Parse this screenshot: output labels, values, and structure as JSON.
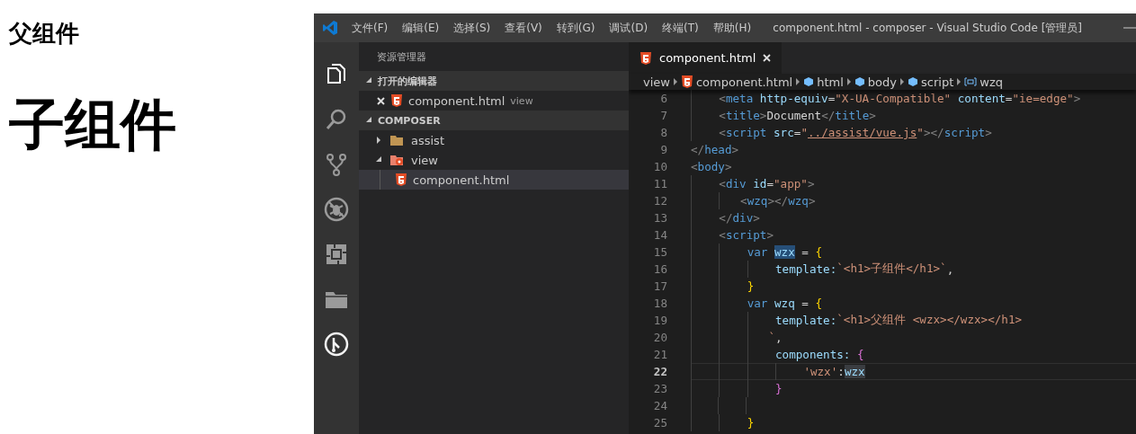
{
  "page": {
    "headings": [
      {
        "text": "父组件",
        "kind": "small"
      },
      {
        "text": "子组件",
        "kind": "large"
      }
    ]
  },
  "window": {
    "title": "component.html - composer - Visual Studio Code [管理员]",
    "menu": [
      "文件(F)",
      "编辑(E)",
      "选择(S)",
      "查看(V)",
      "转到(G)",
      "调试(D)",
      "终端(T)",
      "帮助(H)"
    ]
  },
  "activity_bar": [
    {
      "kind": "files",
      "selected": true
    },
    {
      "kind": "search",
      "selected": false
    },
    {
      "kind": "source-control",
      "selected": false
    },
    {
      "kind": "debug",
      "selected": false
    },
    {
      "kind": "extensions",
      "selected": false
    },
    {
      "kind": "folder",
      "selected": false
    },
    {
      "kind": "branch",
      "selected": false
    }
  ],
  "sidebar": {
    "title": "资源管理器",
    "sections": [
      {
        "title": "打开的编辑器",
        "expanded": true,
        "items": [
          {
            "label": "component.html",
            "description": "view",
            "kind": "file",
            "selected": false
          }
        ]
      },
      {
        "title": "COMPOSER",
        "expanded": true,
        "items": [
          {
            "label": "assist",
            "kind": "folder",
            "expanded": false,
            "selected": false
          },
          {
            "label": "view",
            "kind": "vue-folder",
            "expanded": true,
            "selected": false,
            "children": [
              {
                "label": "component.html",
                "kind": "file",
                "selected": true
              }
            ]
          }
        ]
      }
    ]
  },
  "editor": {
    "tabs": [
      {
        "label": "component.html",
        "selected": true
      }
    ],
    "breadcrumb": [
      {
        "label": "view",
        "kind": "folder"
      },
      {
        "label": "component.html",
        "kind": "file"
      },
      {
        "label": "html",
        "kind": "element"
      },
      {
        "label": "body",
        "kind": "element"
      },
      {
        "label": "script",
        "kind": "element"
      },
      {
        "label": "wzq",
        "kind": "variable"
      }
    ],
    "lines": [
      {
        "number": "6",
        "current": false,
        "tokens": [
          {
            "text": "    <",
            "kind": "punct"
          },
          {
            "text": "meta",
            "kind": "tag"
          },
          {
            "text": " http-equiv",
            "kind": "attr"
          },
          {
            "text": "=",
            "kind": "text"
          },
          {
            "text": "\"X-UA-Compatible\"",
            "kind": "string"
          },
          {
            "text": " content",
            "kind": "attr"
          },
          {
            "text": "=",
            "kind": "text"
          },
          {
            "text": "\"ie=edge\"",
            "kind": "string"
          },
          {
            "text": ">",
            "kind": "punct"
          }
        ]
      },
      {
        "number": "7",
        "current": false,
        "tokens": [
          {
            "text": "    <",
            "kind": "punct"
          },
          {
            "text": "title",
            "kind": "tag"
          },
          {
            "text": ">",
            "kind": "punct"
          },
          {
            "text": "Document",
            "kind": "text"
          },
          {
            "text": "</",
            "kind": "punct"
          },
          {
            "text": "title",
            "kind": "tag"
          },
          {
            "text": ">",
            "kind": "punct"
          }
        ]
      },
      {
        "number": "8",
        "current": false,
        "tokens": [
          {
            "text": "    <",
            "kind": "punct"
          },
          {
            "text": "script",
            "kind": "tag"
          },
          {
            "text": " src",
            "kind": "attr"
          },
          {
            "text": "=",
            "kind": "text"
          },
          {
            "text": "\"",
            "kind": "string"
          },
          {
            "text": "../assist/vue.js",
            "kind": "link"
          },
          {
            "text": "\"",
            "kind": "string"
          },
          {
            "text": "></",
            "kind": "punct"
          },
          {
            "text": "script",
            "kind": "tag"
          },
          {
            "text": ">",
            "kind": "punct"
          }
        ]
      },
      {
        "number": "9",
        "current": false,
        "tokens": [
          {
            "text": "</",
            "kind": "punct"
          },
          {
            "text": "head",
            "kind": "tag"
          },
          {
            "text": ">",
            "kind": "punct"
          }
        ]
      },
      {
        "number": "10",
        "current": false,
        "tokens": [
          {
            "text": "<",
            "kind": "punct"
          },
          {
            "text": "body",
            "kind": "tag"
          },
          {
            "text": ">",
            "kind": "punct"
          }
        ]
      },
      {
        "number": "11",
        "current": false,
        "tokens": [
          {
            "text": "    <",
            "kind": "punct"
          },
          {
            "text": "div",
            "kind": "tag"
          },
          {
            "text": " id",
            "kind": "attr"
          },
          {
            "text": "=",
            "kind": "text"
          },
          {
            "text": "\"app\"",
            "kind": "string"
          },
          {
            "text": ">",
            "kind": "punct"
          }
        ]
      },
      {
        "number": "12",
        "current": false,
        "tokens": [
          {
            "text": "       <",
            "kind": "punct"
          },
          {
            "text": "wzq",
            "kind": "tag"
          },
          {
            "text": "></",
            "kind": "punct"
          },
          {
            "text": "wzq",
            "kind": "tag"
          },
          {
            "text": ">",
            "kind": "punct"
          }
        ]
      },
      {
        "number": "13",
        "current": false,
        "tokens": [
          {
            "text": "    </",
            "kind": "punct"
          },
          {
            "text": "div",
            "kind": "tag"
          },
          {
            "text": ">",
            "kind": "punct"
          }
        ]
      },
      {
        "number": "14",
        "current": false,
        "tokens": [
          {
            "text": "    <",
            "kind": "punct"
          },
          {
            "text": "script",
            "kind": "tag"
          },
          {
            "text": ">",
            "kind": "punct"
          }
        ]
      },
      {
        "number": "15",
        "current": false,
        "tokens": [
          {
            "text": "        var ",
            "kind": "keyword"
          },
          {
            "text": "wzx",
            "kind": "variable",
            "selection": true
          },
          {
            "text": " = ",
            "kind": "text"
          },
          {
            "text": "{",
            "kind": "brace"
          }
        ]
      },
      {
        "number": "16",
        "current": false,
        "tokens": [
          {
            "text": "            template:",
            "kind": "property"
          },
          {
            "text": "`<h1>子组件</h1>`",
            "kind": "string"
          },
          {
            "text": ",",
            "kind": "text"
          }
        ]
      },
      {
        "number": "17",
        "current": false,
        "tokens": [
          {
            "text": "        }",
            "kind": "brace"
          }
        ]
      },
      {
        "number": "18",
        "current": false,
        "tokens": [
          {
            "text": "        var ",
            "kind": "keyword"
          },
          {
            "text": "wzq",
            "kind": "variable"
          },
          {
            "text": " = ",
            "kind": "text"
          },
          {
            "text": "{",
            "kind": "brace"
          }
        ]
      },
      {
        "number": "19",
        "current": false,
        "tokens": [
          {
            "text": "            template:",
            "kind": "property"
          },
          {
            "text": "`<h1>父组件 <wzx></wzx></h1>",
            "kind": "string"
          }
        ]
      },
      {
        "number": "20",
        "current": false,
        "tokens": [
          {
            "text": "           `",
            "kind": "string"
          },
          {
            "text": ",",
            "kind": "text"
          }
        ]
      },
      {
        "number": "21",
        "current": false,
        "tokens": [
          {
            "text": "            components: ",
            "kind": "property"
          },
          {
            "text": "{",
            "kind": "brace2"
          }
        ]
      },
      {
        "number": "22",
        "current": true,
        "tokens": [
          {
            "text": "                'wzx'",
            "kind": "string"
          },
          {
            "text": ":",
            "kind": "text"
          },
          {
            "text": "wzx",
            "kind": "variable",
            "occurrence": true
          }
        ]
      },
      {
        "number": "23",
        "current": false,
        "tokens": [
          {
            "text": "            }",
            "kind": "brace2"
          }
        ]
      },
      {
        "number": "24",
        "current": false
      },
      {
        "number": "25",
        "current": false,
        "tokens": [
          {
            "text": "        }",
            "kind": "brace"
          }
        ]
      }
    ]
  }
}
